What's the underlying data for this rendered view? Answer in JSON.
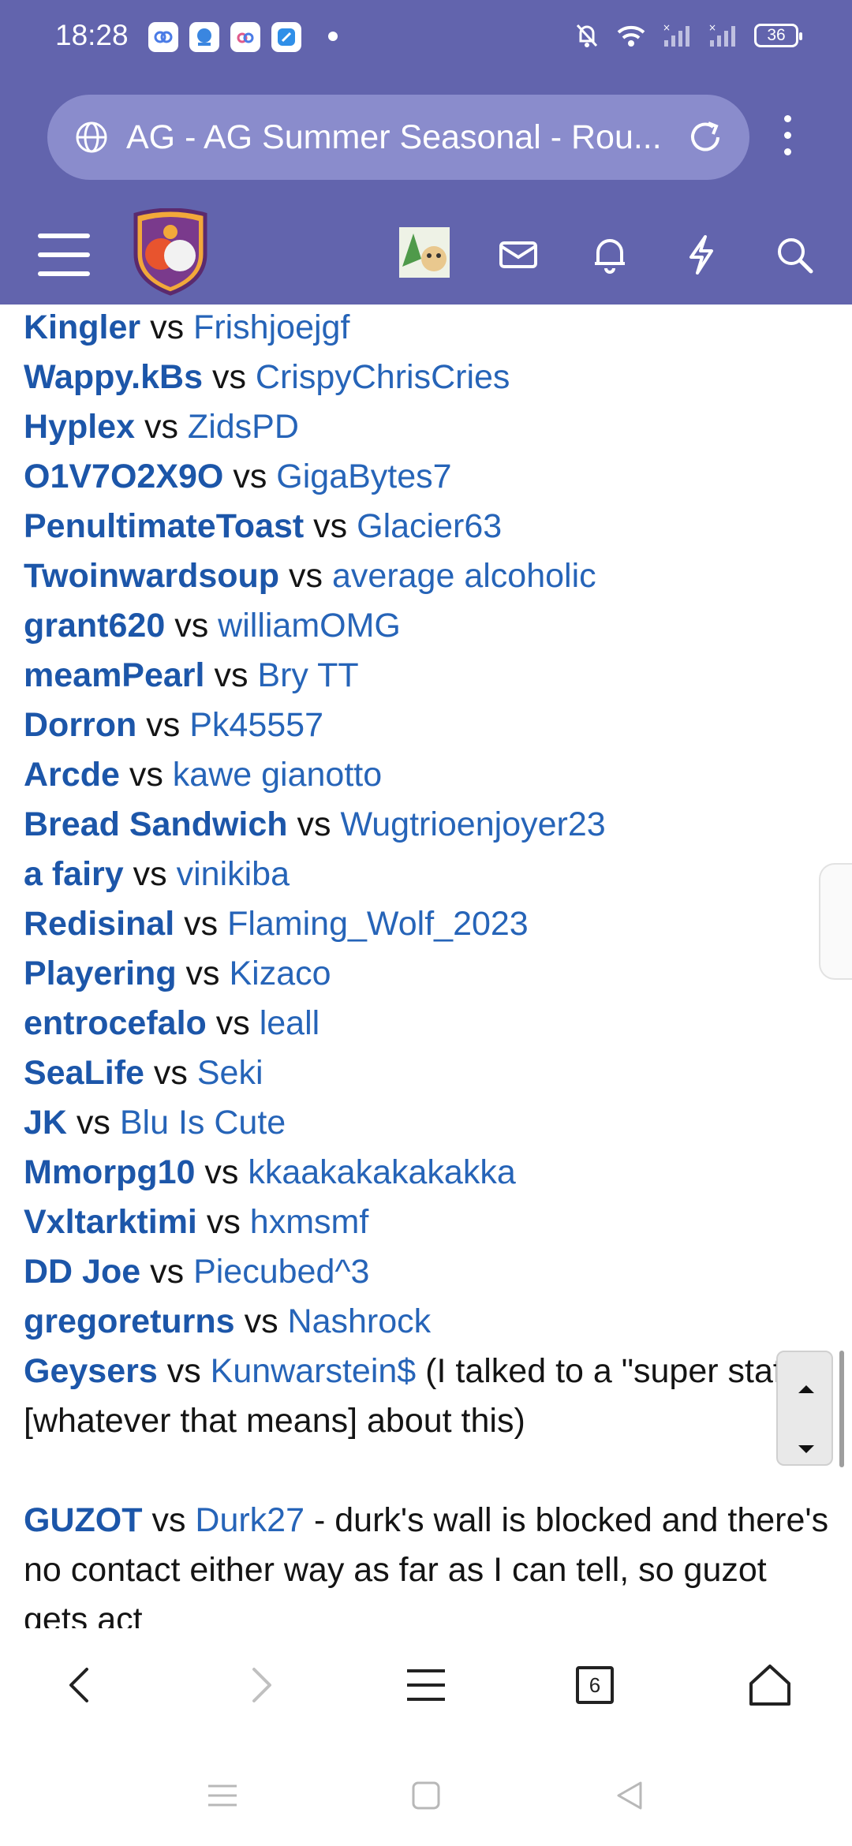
{
  "status_bar": {
    "time": "18:28",
    "battery": "36"
  },
  "browser": {
    "url_title": "AG - AG Summer Seasonal - Rou...",
    "tab_count": "6"
  },
  "matches": [
    {
      "p1": "Kingler",
      "vs": "vs",
      "p2": "Frishjoejgf"
    },
    {
      "p1": "Wappy.kBs",
      "vs": "vs",
      "p2": "CrispyChrisCries"
    },
    {
      "p1": "Hyplex",
      "vs": "vs",
      "p2": "ZidsPD"
    },
    {
      "p1": "O1V7O2X9O",
      "vs": "vs",
      "p2": "GigaBytes7"
    },
    {
      "p1": "PenultimateToast",
      "vs": "vs",
      "p2": "Glacier63"
    },
    {
      "p1": "Twoinwardsoup",
      "vs": "vs",
      "p2": "average alcoholic"
    },
    {
      "p1": "grant620",
      "vs": "vs",
      "p2": "williamOMG"
    },
    {
      "p1": "meamPearl",
      "vs": "vs",
      "p2": "Bry TT"
    },
    {
      "p1": "Dorron",
      "vs": "vs",
      "p2": "Pk45557"
    },
    {
      "p1": "Arcde",
      "vs": "vs",
      "p2": "kawe gianotto"
    },
    {
      "p1": "Bread Sandwich",
      "vs": "vs",
      "p2": "Wugtrioenjoyer23"
    },
    {
      "p1": "a fairy",
      "vs": "vs",
      "p2": "vinikiba"
    },
    {
      "p1": "Redisinal",
      "vs": "vs",
      "p2": "Flaming_Wolf_2023"
    },
    {
      "p1": "Playering",
      "vs": "vs",
      "p2": "Kizaco"
    },
    {
      "p1": "entrocefalo",
      "vs": "vs",
      "p2": "leall"
    },
    {
      "p1": "SeaLife",
      "vs": "vs",
      "p2": "Seki"
    },
    {
      "p1": "JK",
      "vs": "vs",
      "p2": "Blu Is Cute"
    },
    {
      "p1": "Mmorpg10",
      "vs": "vs",
      "p2": "kkaakakakakakka"
    },
    {
      "p1": "Vxltarktimi",
      "vs": "vs",
      "p2": "hxmsmf"
    },
    {
      "p1": "DD Joe",
      "vs": "vs",
      "p2": "Piecubed^3"
    },
    {
      "p1": "gregoreturns",
      "vs": "vs",
      "p2": "Nashrock"
    }
  ],
  "geysers_match": {
    "p1": "Geysers",
    "vs": "vs",
    "p2": "Kunwarstein$",
    "note": "(I talked to a \"super staff\" [whatever that means] about this)"
  },
  "guzot_match": {
    "p1": "GUZOT",
    "vs": "vs",
    "p2": "Durk27",
    "note": "- durk's wall is blocked and there's no contact either way as far as I can tell, so guzot gets act"
  }
}
